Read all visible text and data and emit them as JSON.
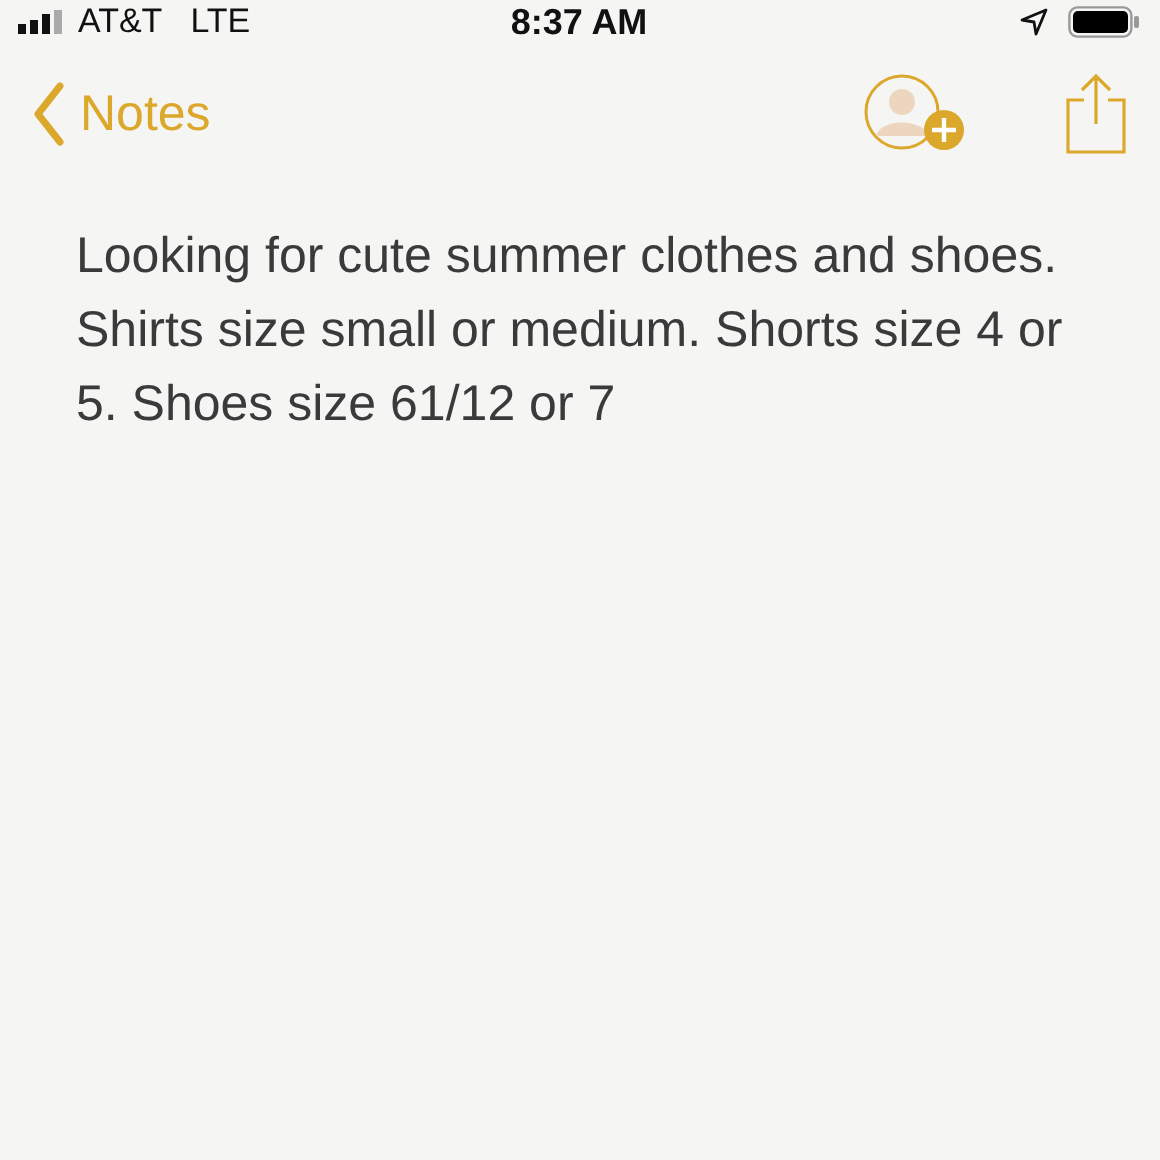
{
  "status_bar": {
    "carrier": "AT&T",
    "network": "LTE",
    "time": "8:37 AM"
  },
  "nav_bar": {
    "back_label": "Notes"
  },
  "note": {
    "body": "Looking for cute summer clothes and shoes. Shirts size small or medium. Shorts size 4 or 5. Shoes size 61/12 or 7"
  }
}
